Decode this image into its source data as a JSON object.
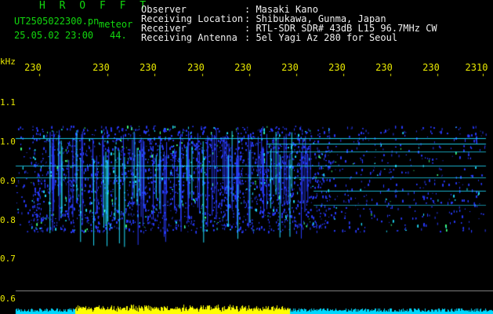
{
  "header": {
    "app_title": "H R O F F T",
    "file_name": "UT2505022300.pn",
    "file_sub": "meteor",
    "date_time": "25.05.02 23:00",
    "date_sub": "44.",
    "info": [
      {
        "label": "Observer",
        "value": ": Masaki Kano"
      },
      {
        "label": "Receiving Location",
        "value": ": Shibukawa, Gunma, Japan"
      },
      {
        "label": "Receiver",
        "value": ": RTL-SDR SDR# 43dB L15 96.7MHz CW"
      },
      {
        "label": "Receiving Antenna",
        "value": ": 5el Yagi Az 280 for Seoul"
      }
    ]
  },
  "axes": {
    "y_unit": "kHz",
    "x_ticks": [
      "230",
      "230",
      "230",
      "230",
      "230",
      "230",
      "230",
      "230",
      "230",
      "2310"
    ],
    "y_ticks": [
      "1.1",
      "1.0",
      "0.9",
      "0.8",
      "0.7",
      "0.6"
    ]
  },
  "colors": {
    "background": "#000000",
    "green_text": "#12d80e",
    "yellow_text": "#e8e800",
    "white_text": "#f0f0f0",
    "signal_blue": "#2a3cff",
    "signal_cyan": "#20e0ff",
    "signal_green": "#40ff80",
    "baseline_yellow": "#ffff00",
    "baseline_cyan": "#00d8ff"
  }
}
